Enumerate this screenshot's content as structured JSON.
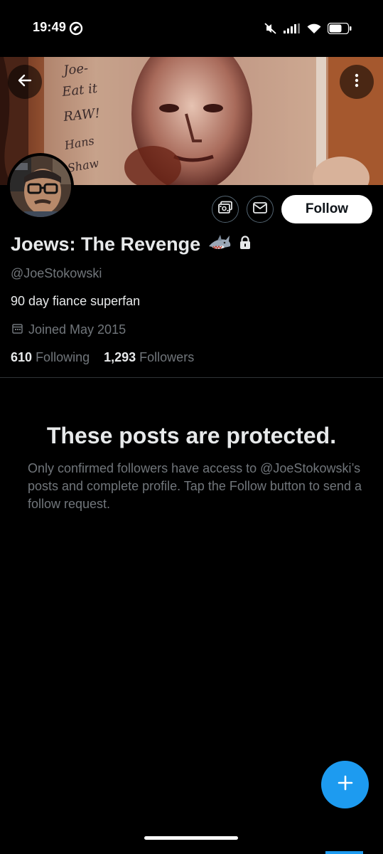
{
  "status_bar": {
    "time": "19:49",
    "icons": [
      "app-notification-icon",
      "mute-icon",
      "signal-icon",
      "wifi-icon",
      "battery-icon"
    ]
  },
  "banner": {
    "image_text": "Joe- Eat it RAW! Hans Shaw",
    "icons": [
      "back-arrow-icon",
      "more-vertical-icon"
    ]
  },
  "profile": {
    "display_name": "Joews: The Revenge",
    "name_emoji_icon": "shark-icon",
    "locked_icon": "lock-icon",
    "handle": "@JoeStokowski",
    "bio": "90 day fiance superfan",
    "joined": "Joined May 2015",
    "following_count": "610",
    "following_label": "Following",
    "followers_count": "1,293",
    "followers_label": "Followers"
  },
  "actions": {
    "subscribe_icon": "subscriptions-icon",
    "message_icon": "envelope-icon",
    "follow_label": "Follow"
  },
  "protected": {
    "title": "These posts are protected.",
    "body": "Only confirmed followers have access to @JoeStokowski’s posts and complete profile. Tap the Follow button to send a follow request."
  },
  "fab": {
    "icon": "plus-icon"
  },
  "colors": {
    "background": "#000000",
    "text_primary": "#e7e9ea",
    "text_secondary": "#71767b",
    "accent": "#1d9bf0",
    "follow_button_bg": "#ffffff"
  }
}
